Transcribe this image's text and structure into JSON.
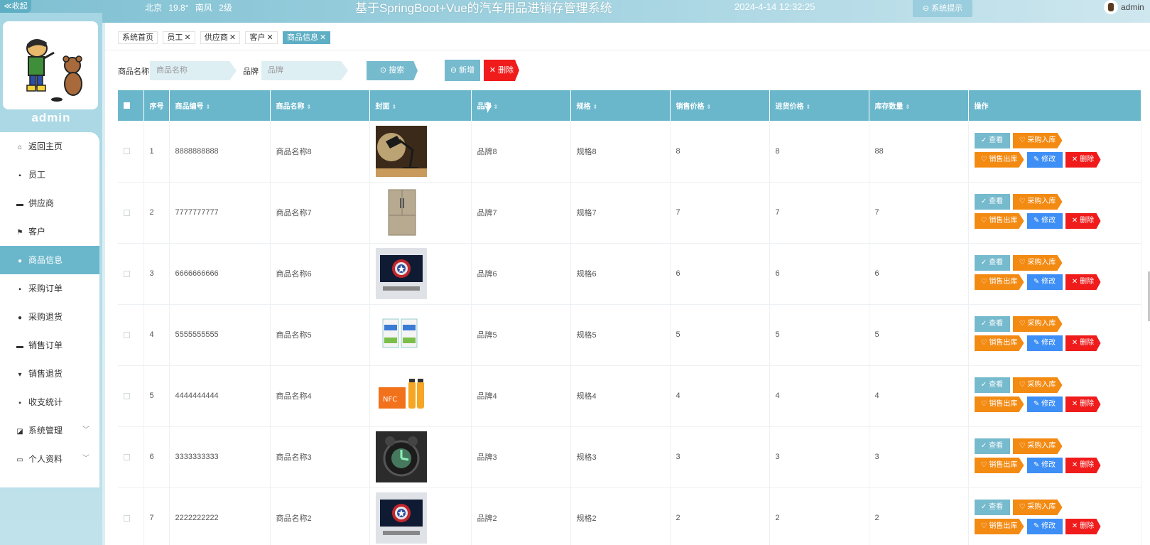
{
  "topbar": {
    "collapse_label": "≪收起",
    "weather": {
      "city": "北京",
      "temp": "19.8°",
      "wind": "南风",
      "level": "2级"
    },
    "title": "基于SpringBoot+Vue的汽车用品进销存管理系统",
    "datetime": "2024-4-14 12:32:25",
    "sys_tip_label": "⊖ 系统提示",
    "user_name": "admin"
  },
  "sidebar": {
    "user_name": "admin",
    "items": [
      {
        "label": "返回主页",
        "icon": "home-icon",
        "glyph": "⌂",
        "active": false
      },
      {
        "label": "员工",
        "icon": "grid-icon",
        "glyph": "▪",
        "active": false
      },
      {
        "label": "供应商",
        "icon": "monitor-icon",
        "glyph": "▬",
        "active": false
      },
      {
        "label": "客户",
        "icon": "flag-icon",
        "glyph": "⚑",
        "active": false
      },
      {
        "label": "商品信息",
        "icon": "user-icon",
        "glyph": "●",
        "active": true
      },
      {
        "label": "采购订单",
        "icon": "grid-icon",
        "glyph": "▪",
        "active": false
      },
      {
        "label": "采购退货",
        "icon": "location-icon",
        "glyph": "●",
        "active": false
      },
      {
        "label": "销售订单",
        "icon": "briefcase-icon",
        "glyph": "▬",
        "active": false
      },
      {
        "label": "销售退货",
        "icon": "trophy-icon",
        "glyph": "▾",
        "active": false
      },
      {
        "label": "收支统计",
        "icon": "grid-icon",
        "glyph": "▪",
        "active": false
      },
      {
        "label": "系统管理",
        "icon": "chart-icon",
        "glyph": "◪",
        "active": false,
        "expandable": true
      },
      {
        "label": "个人资料",
        "icon": "card-icon",
        "glyph": "▭",
        "active": false,
        "expandable": true
      }
    ]
  },
  "tags": [
    {
      "label": "系统首页",
      "closable": false,
      "active": false
    },
    {
      "label": "员工",
      "closable": true,
      "active": false
    },
    {
      "label": "供应商",
      "closable": true,
      "active": false
    },
    {
      "label": "客户",
      "closable": true,
      "active": false
    },
    {
      "label": "商品信息",
      "closable": true,
      "active": true
    }
  ],
  "search": {
    "name_label": "商品名称",
    "name_placeholder": "商品名称",
    "brand_label": "品牌",
    "brand_placeholder": "品牌",
    "search_btn": "⊙ 搜索",
    "add_btn": "⊖ 新增",
    "delete_btn": "✕ 删除"
  },
  "table": {
    "headers": [
      "序号",
      "商品编号",
      "商品名称",
      "封面",
      "品牌",
      "规格",
      "销售价格",
      "进货价格",
      "库存数量",
      "操作"
    ],
    "rows": [
      {
        "index": "1",
        "code": "8888888888",
        "name": "商品名称8",
        "cover": "desk-lamp",
        "brand": "品牌8",
        "spec": "规格8",
        "sale_price": "8",
        "purchase_price": "8",
        "stock": "88"
      },
      {
        "index": "2",
        "code": "7777777777",
        "name": "商品名称7",
        "cover": "refrigerator",
        "brand": "品牌7",
        "spec": "规格7",
        "sale_price": "7",
        "purchase_price": "7",
        "stock": "7"
      },
      {
        "index": "3",
        "code": "6666666666",
        "name": "商品名称6",
        "cover": "monitor-shield",
        "brand": "品牌6",
        "spec": "规格6",
        "sale_price": "6",
        "purchase_price": "6",
        "stock": "6"
      },
      {
        "index": "4",
        "code": "5555555555",
        "name": "商品名称5",
        "cover": "milk-boxes",
        "brand": "品牌5",
        "spec": "规格5",
        "sale_price": "5",
        "purchase_price": "5",
        "stock": "5"
      },
      {
        "index": "5",
        "code": "4444444444",
        "name": "商品名称4",
        "cover": "juice-box",
        "brand": "品牌4",
        "spec": "规格4",
        "sale_price": "4",
        "purchase_price": "4",
        "stock": "4"
      },
      {
        "index": "6",
        "code": "3333333333",
        "name": "商品名称3",
        "cover": "alarm-clock",
        "brand": "品牌3",
        "spec": "规格3",
        "sale_price": "3",
        "purchase_price": "3",
        "stock": "3"
      },
      {
        "index": "7",
        "code": "2222222222",
        "name": "商品名称2",
        "cover": "monitor-shield",
        "brand": "品牌2",
        "spec": "规格2",
        "sale_price": "2",
        "purchase_price": "2",
        "stock": "2"
      }
    ],
    "actions": {
      "view": "✓ 查看",
      "stock_in": "♡ 采购入库",
      "stock_out": "♡ 销售出库",
      "edit": "✎ 修改",
      "delete": "✕ 删除"
    }
  },
  "colors": {
    "accent": "#6ab7cc",
    "orange": "#f38a12",
    "blue": "#3d8ef5",
    "danger": "#f01b1b"
  }
}
